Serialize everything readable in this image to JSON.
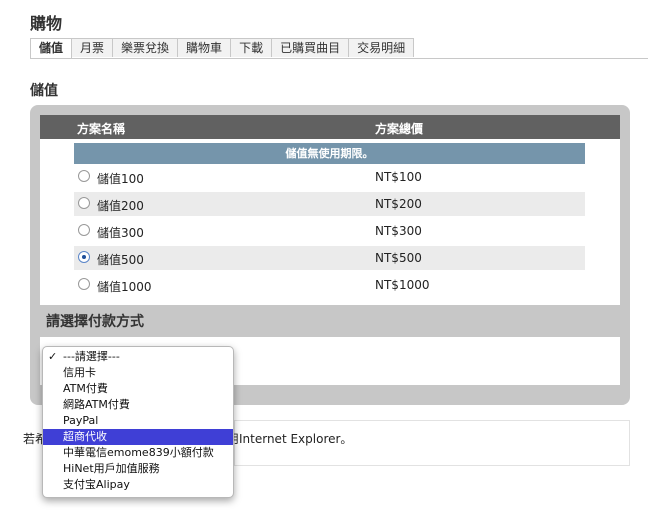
{
  "page": {
    "title": "購物"
  },
  "tabs": [
    {
      "label": "儲值",
      "active": true
    },
    {
      "label": "月票"
    },
    {
      "label": "樂票兌換"
    },
    {
      "label": "購物車"
    },
    {
      "label": "下載"
    },
    {
      "label": "已購買曲目"
    },
    {
      "label": "交易明細"
    }
  ],
  "section": {
    "title": "儲值"
  },
  "plans": {
    "header_name": "方案名稱",
    "header_price": "方案總價",
    "notice": "儲值無使用期限。",
    "rows": [
      {
        "name": "儲值100",
        "price": "NT$100",
        "checked": false
      },
      {
        "name": "儲值200",
        "price": "NT$200",
        "checked": false
      },
      {
        "name": "儲值300",
        "price": "NT$300",
        "checked": false
      },
      {
        "name": "儲值500",
        "price": "NT$500",
        "checked": true
      },
      {
        "name": "儲值1000",
        "price": "NT$1000",
        "checked": false
      }
    ]
  },
  "payment": {
    "title": "請選擇付款方式",
    "options": [
      "---請選擇---",
      "信用卡",
      "ATM付費",
      "網路ATM付費",
      "PayPal",
      "超商代收",
      "中華電信emome839小額付款",
      "HiNet用戶加值服務",
      "支付宝Alipay"
    ],
    "checked_index": 0,
    "highlighted_index": 5
  },
  "info": {
    "text": "若希望以手機小額付費方式儲值，請使用Internet Explorer。"
  },
  "colors": {
    "header_bg": "#616161",
    "notice_bg": "#7595ab",
    "highlight": "#3f3fd6",
    "panel_bg": "#c7c7c7"
  }
}
